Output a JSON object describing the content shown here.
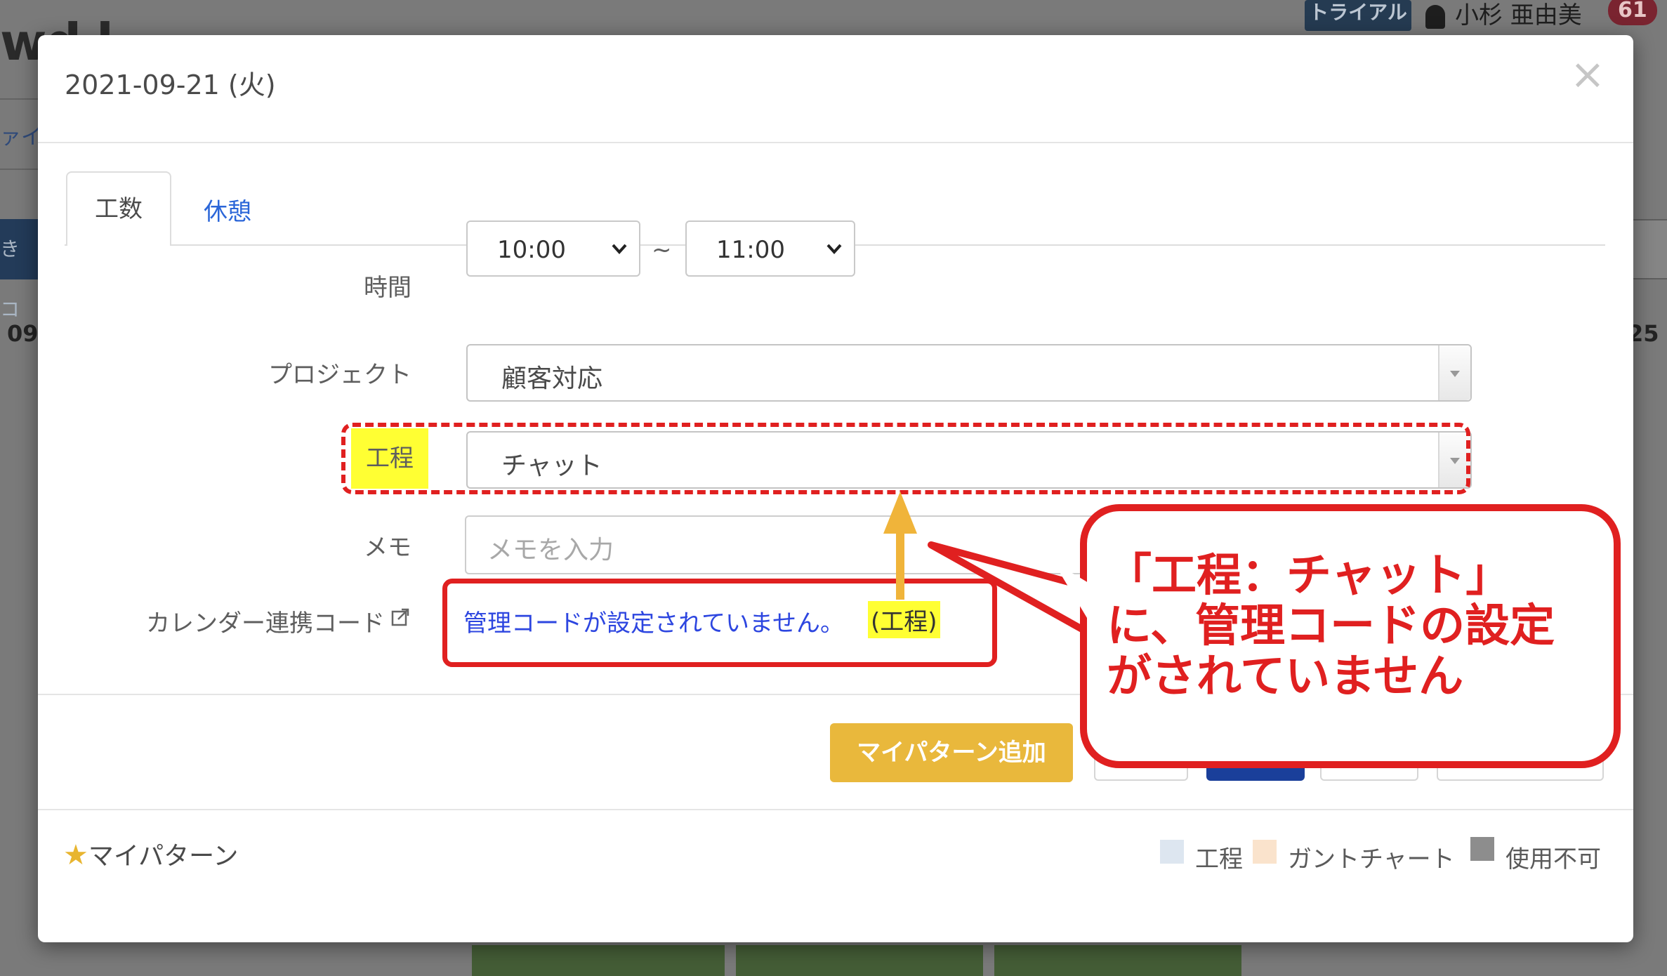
{
  "background": {
    "logo_fragment": "wd l",
    "trial_badge": "トライアル",
    "user_name": "小杉 亜由美",
    "notification_count": "61",
    "left_link_fragment": "ァイ",
    "left_button_fragment": "きコ",
    "left_date_fragment": "09",
    "right_date_fragment": "25"
  },
  "modal": {
    "title": "2021-09-21 (火)",
    "close_symbol": "×",
    "tabs": [
      {
        "label": "工数",
        "active": true
      },
      {
        "label": "休憩",
        "active": false
      }
    ],
    "form": {
      "time_label": "時間",
      "time_start": "10:00",
      "time_separator": "~",
      "time_end": "11:00",
      "project_label": "プロジェクト",
      "project_value": "顧客対応",
      "process_label": "工程",
      "process_value": "チャット",
      "memo_label": "メモ",
      "memo_placeholder": "メモを入力",
      "calendar_code_label": "カレンダー連携コード",
      "calendar_code_message": "管理コードが設定されていません。",
      "calendar_code_suffix": "(工程)"
    },
    "footer": {
      "add_pattern_button": "マイパターン追加"
    },
    "my_pattern": {
      "star": "★",
      "label": "マイパターン"
    },
    "legend": [
      {
        "label": "工程",
        "color": "#dde6f0"
      },
      {
        "label": "ガントチャート",
        "color": "#fae3cc"
      },
      {
        "label": "使用不可",
        "color": "#8d8d8d"
      }
    ]
  },
  "annotation": {
    "callout_text": "「工程：チャット」に、管理コードの設定がされていません",
    "accent_color": "#e02020",
    "arrow_color": "#f0b43a",
    "highlight_color": "#ffff33"
  }
}
